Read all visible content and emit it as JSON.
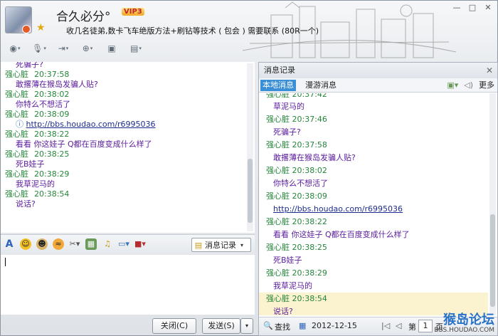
{
  "header": {
    "nickname": "合久必分°",
    "vip_badge": "VIP3",
    "signature": "收几名徒弟,数卡飞车绝版方法+刷钻等技术 ( 包会 )  需要联系 (80R一个)",
    "toolbar_icons": [
      "video-call-icon",
      "voice-icon",
      "transfer-file-icon",
      "add-member-icon",
      "remote-desktop-icon",
      "app-icon"
    ],
    "window_controls": [
      "—",
      "□",
      "×"
    ]
  },
  "chat": {
    "top_fragment": "死骗子?",
    "messages": [
      {
        "sender": "强心脏",
        "time": "20:37:58",
        "text": "敢撂薄在猴岛发骗人贴?"
      },
      {
        "sender": "强心脏",
        "time": "20:38:02",
        "text": "你特么不想活了"
      },
      {
        "sender": "强心脏",
        "time": "20:38:09",
        "link": "http://bbs.houdao.com/r6995036"
      },
      {
        "sender": "强心脏",
        "time": "20:38:22",
        "text": "看看 你这娃子 Q都在百度变成什么样了"
      },
      {
        "sender": "强心脏",
        "time": "20:38:25",
        "text": "死B娃子"
      },
      {
        "sender": "强心脏",
        "time": "20:38:29",
        "text": "我草泥马的"
      },
      {
        "sender": "强心脏",
        "time": "20:38:54",
        "text": "说话?"
      }
    ]
  },
  "input_toolbar": {
    "icons": [
      "font-icon",
      "emoji-icon",
      "magic-emoji-icon",
      "shake-icon",
      "screenshot-icon",
      "image-icon",
      "music-icon",
      "screen-share-icon",
      "gift-icon"
    ],
    "history_label": "消息记录"
  },
  "buttons": {
    "close_label": "关闭(C)",
    "send_label": "发送(S)"
  },
  "history": {
    "title": "消息记录",
    "tab_local": "本地消息",
    "tab_roam": "漫游消息",
    "more_label": "更多",
    "partial_top": "强心脏  20:37:42",
    "rows": [
      {
        "kind": "body",
        "text": "草泥马的"
      },
      {
        "kind": "head",
        "text": "强心脏  20:37:46"
      },
      {
        "kind": "body",
        "text": "死骗子?"
      },
      {
        "kind": "head",
        "text": "强心脏  20:37:58"
      },
      {
        "kind": "body",
        "text": "敢撂薄在猴岛发骗人贴?"
      },
      {
        "kind": "head",
        "text": "强心脏  20:38:02"
      },
      {
        "kind": "body",
        "text": "你特么不想活了"
      },
      {
        "kind": "head",
        "text": "强心脏  20:38:09"
      },
      {
        "kind": "link",
        "text": "http://bbs.houdao.com/r6995036"
      },
      {
        "kind": "head",
        "text": "强心脏  20:38:22"
      },
      {
        "kind": "body",
        "text": "看看 你这娃子 Q都在百度变成什么样了"
      },
      {
        "kind": "head",
        "text": "强心脏  20:38:25"
      },
      {
        "kind": "body",
        "text": "死B娃子"
      },
      {
        "kind": "head",
        "text": "强心脏  20:38:29"
      },
      {
        "kind": "body",
        "text": "我草泥马的"
      },
      {
        "kind": "head",
        "text": "强心脏  20:38:54",
        "highlight": true
      },
      {
        "kind": "body",
        "text": "说话?",
        "highlight": true
      }
    ],
    "footer": {
      "search_label": "查找",
      "date": "2012-12-15",
      "page_prefix": "第",
      "page_value": "1",
      "page_suffix": "页"
    }
  },
  "watermark": {
    "line1": "猴岛论坛",
    "line2": "BBS.HOUDAO.COM"
  },
  "colors": {
    "sender_green": "#25863a",
    "message_purple": "#5a1c9e",
    "tab_active_blue": "#3b8fd6",
    "highlight_row": "#fbf2cf"
  }
}
